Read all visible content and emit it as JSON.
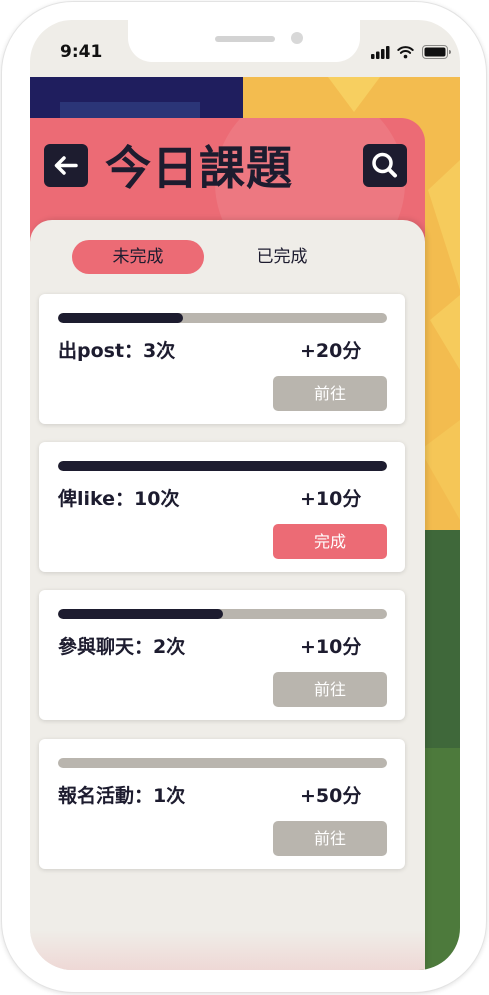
{
  "status_bar": {
    "time": "9:41",
    "icons": [
      "signal-icon",
      "wifi-icon",
      "battery-icon"
    ]
  },
  "header": {
    "title": "今日課題",
    "back_icon": "arrow-left-icon",
    "search_icon": "search-icon"
  },
  "tabs": [
    {
      "label": "未完成",
      "selected": true
    },
    {
      "label": "已完成",
      "selected": false
    }
  ],
  "tasks": [
    {
      "label": "出post：3次",
      "points": "+20分",
      "progress": 0.38,
      "completed": false,
      "button_label": "前往"
    },
    {
      "label": "俾like：10次",
      "points": "+10分",
      "progress": 1.0,
      "completed": true,
      "button_label": "完成"
    },
    {
      "label": "參與聊天：2次",
      "points": "+10分",
      "progress": 0.5,
      "completed": false,
      "button_label": "前往"
    },
    {
      "label": "報名活動：1次",
      "points": "+50分",
      "progress": 0,
      "completed": false,
      "button_label": "前往"
    }
  ],
  "colors": {
    "accent": "#ec6b75",
    "dark": "#1d1c2f",
    "muted": "#b9b5ae"
  }
}
